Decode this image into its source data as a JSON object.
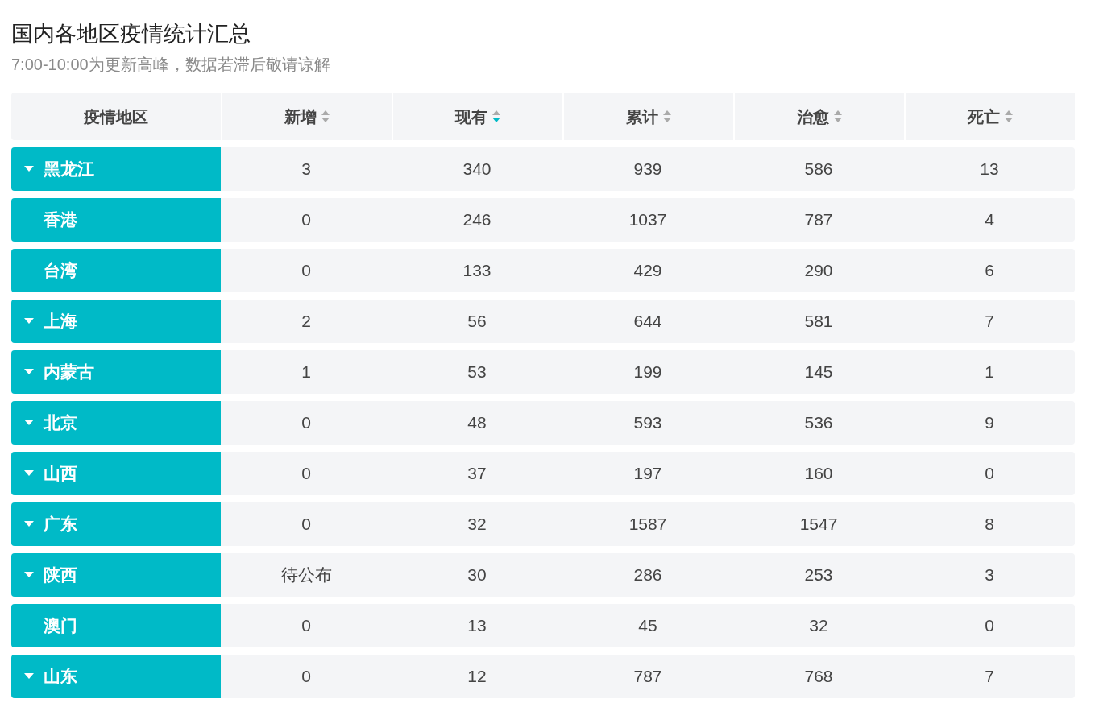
{
  "title": "国内各地区疫情统计汇总",
  "subtitle": "7:00-10:00为更新高峰，数据若滞后敬请谅解",
  "table": {
    "columns": [
      {
        "label": "疫情地区"
      },
      {
        "label": "新增",
        "sorted": false
      },
      {
        "label": "现有",
        "sorted": true
      },
      {
        "label": "累计",
        "sorted": false
      },
      {
        "label": "治愈",
        "sorted": false
      },
      {
        "label": "死亡",
        "sorted": false
      }
    ],
    "rows": [
      {
        "expandable": true,
        "cells": [
          "黑龙江",
          "3",
          "340",
          "939",
          "586",
          "13"
        ]
      },
      {
        "expandable": false,
        "cells": [
          "香港",
          "0",
          "246",
          "1037",
          "787",
          "4"
        ]
      },
      {
        "expandable": false,
        "cells": [
          "台湾",
          "0",
          "133",
          "429",
          "290",
          "6"
        ]
      },
      {
        "expandable": true,
        "cells": [
          "上海",
          "2",
          "56",
          "644",
          "581",
          "7"
        ]
      },
      {
        "expandable": true,
        "cells": [
          "内蒙古",
          "1",
          "53",
          "199",
          "145",
          "1"
        ]
      },
      {
        "expandable": true,
        "cells": [
          "北京",
          "0",
          "48",
          "593",
          "536",
          "9"
        ]
      },
      {
        "expandable": true,
        "cells": [
          "山西",
          "0",
          "37",
          "197",
          "160",
          "0"
        ]
      },
      {
        "expandable": true,
        "cells": [
          "广东",
          "0",
          "32",
          "1587",
          "1547",
          "8"
        ]
      },
      {
        "expandable": true,
        "cells": [
          "陕西",
          "待公布",
          "30",
          "286",
          "253",
          "3"
        ]
      },
      {
        "expandable": false,
        "cells": [
          "澳门",
          "0",
          "13",
          "45",
          "32",
          "0"
        ]
      },
      {
        "expandable": true,
        "cells": [
          "山东",
          "0",
          "12",
          "787",
          "768",
          "7"
        ]
      }
    ]
  }
}
